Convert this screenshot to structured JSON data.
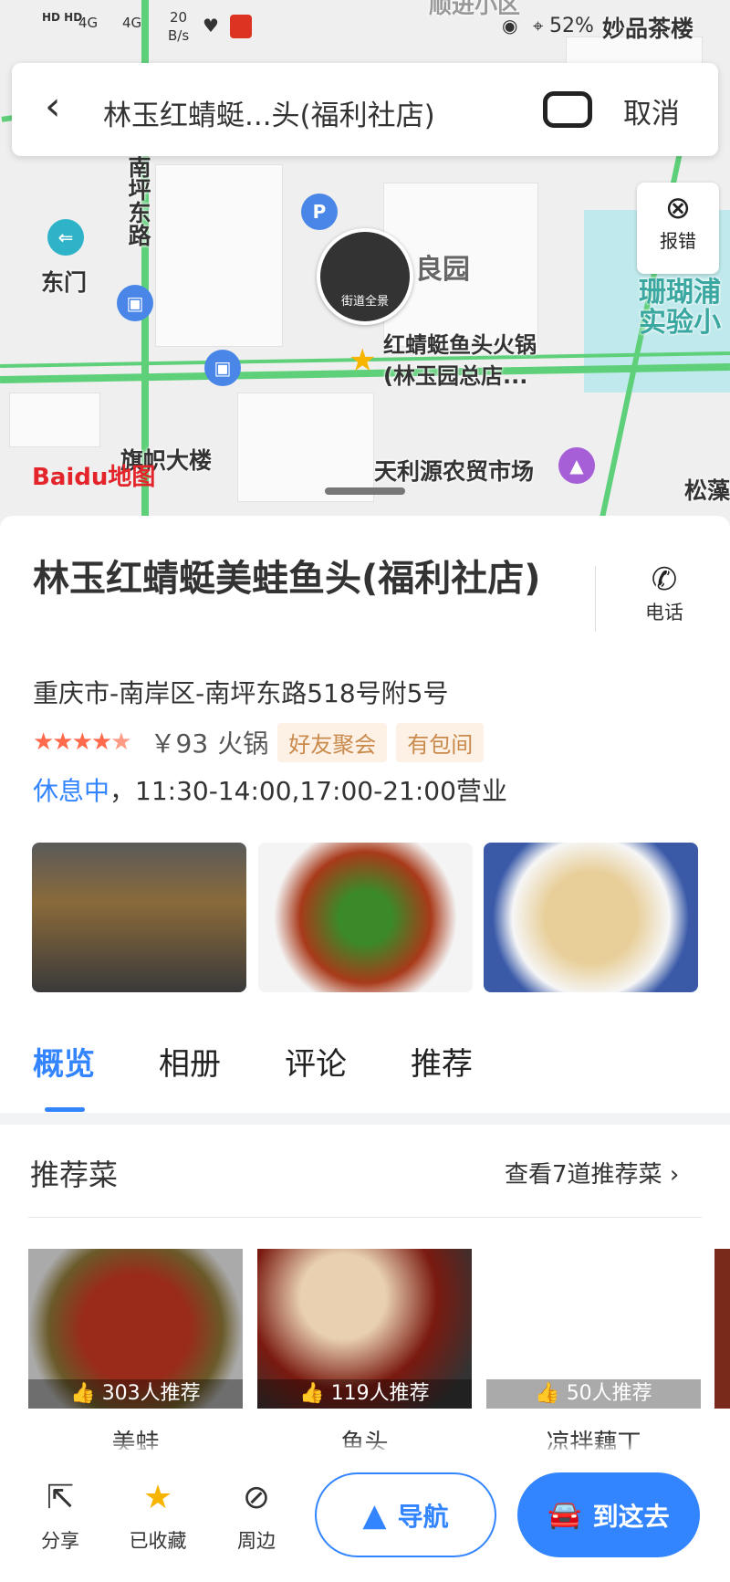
{
  "status_bar": {
    "speed": "20",
    "speed_unit": "B/s",
    "battery": "52%",
    "network1": "4G",
    "network2": "4G"
  },
  "map": {
    "labels": [
      "南坪东路",
      "东门",
      "良园",
      "红蜻蜓鱼头火锅",
      "(林玉园总店...",
      "旗帜大楼",
      "天利源农贸市场",
      "松藻",
      "珊瑚浦",
      "实验小",
      "妙品茶楼",
      "顺进小区"
    ],
    "street_view_label": "街道全景",
    "logo": "Baidu地图",
    "report_label": "报错"
  },
  "search": {
    "title": "林玉红蜻蜓...头(福利社店)",
    "cancel": "取消"
  },
  "place": {
    "name": "林玉红蜻蜓美蛙鱼头(福利社店)",
    "phone_label": "电话",
    "address": "重庆市-南岸区-南坪东路518号附5号",
    "rating": 4.5,
    "price": "￥93",
    "category": "火锅",
    "tags": [
      "好友聚会",
      "有包间"
    ],
    "status": "休息中",
    "hours": "，11:30-14:00,17:00-21:00营业"
  },
  "tabs": [
    {
      "label": "概览",
      "active": true
    },
    {
      "label": "相册"
    },
    {
      "label": "评论"
    },
    {
      "label": "推荐"
    }
  ],
  "dishes": {
    "title": "推荐菜",
    "more": "查看7道推荐菜",
    "items": [
      {
        "name": "美蛙",
        "count": "303人推荐"
      },
      {
        "name": "鱼头",
        "count": "119人推荐"
      },
      {
        "name": "凉拌藕丁",
        "count": "50人推荐"
      }
    ]
  },
  "bottom": {
    "share": "分享",
    "favorite": "已收藏",
    "nearby": "周边",
    "navigate": "导航",
    "go": "到这去"
  },
  "colors": {
    "accent": "#3385ff",
    "star": "#ff6a4d",
    "road": "#5fd07a"
  }
}
